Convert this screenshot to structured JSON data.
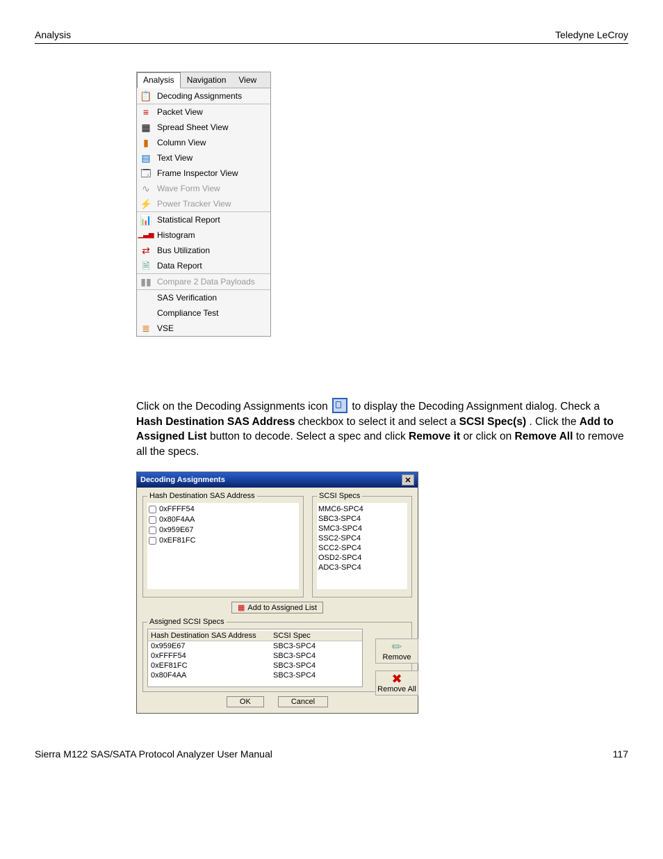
{
  "header": {
    "left": "Analysis",
    "right": "Teledyne LeCroy"
  },
  "menu": {
    "tabs": [
      "Analysis",
      "Navigation",
      "View"
    ],
    "active_tab": 0,
    "sections": [
      [
        {
          "label": "Decoding Assignments",
          "disabled": false
        }
      ],
      [
        {
          "label": "Packet View",
          "disabled": false
        },
        {
          "label": "Spread Sheet View",
          "disabled": false
        },
        {
          "label": "Column View",
          "disabled": false
        },
        {
          "label": "Text View",
          "disabled": false
        },
        {
          "label": "Frame Inspector View",
          "disabled": false
        },
        {
          "label": "Wave Form View",
          "disabled": true
        },
        {
          "label": "Power Tracker View",
          "disabled": true
        }
      ],
      [
        {
          "label": "Statistical Report",
          "disabled": false
        },
        {
          "label": "Histogram",
          "disabled": false
        },
        {
          "label": "Bus Utilization",
          "disabled": false
        },
        {
          "label": "Data Report",
          "disabled": false
        }
      ],
      [
        {
          "label": "Compare 2 Data Payloads",
          "disabled": true
        }
      ],
      [
        {
          "label": "SAS Verification",
          "disabled": false
        },
        {
          "label": "Compliance Test",
          "disabled": false
        },
        {
          "label": "VSE",
          "disabled": false
        }
      ]
    ]
  },
  "paragraph": {
    "p1_a": "Click on the Decoding Assignments icon ",
    "p1_b": " to display the Decoding Assignment dialog. Check a ",
    "p1_bold1": "Hash Destination SAS Address",
    "p1_c": " checkbox to select it and select a ",
    "p1_bold2": "SCSI Spec(s)",
    "p1_d": ". Click the ",
    "p1_bold3": "Add to Assigned List",
    "p1_e": " button to decode. Select a spec and click ",
    "p1_bold4": "Remove it",
    "p1_f": " or click on ",
    "p1_bold5": "Remove All",
    "p1_g": " to remove all the specs."
  },
  "dialog": {
    "title": "Decoding Assignments",
    "hash_legend": "Hash Destination SAS Address",
    "hash_items": [
      "0xFFFF54",
      "0x80F4AA",
      "0x959E67",
      "0xEF81FC"
    ],
    "specs_legend": "SCSI Specs",
    "specs_items": [
      "MMC6-SPC4",
      "SBC3-SPC4",
      "SMC3-SPC4",
      "SSC2-SPC4",
      "SCC2-SPC4",
      "OSD2-SPC4",
      "ADC3-SPC4"
    ],
    "add_btn": "Add  to Assigned List",
    "assigned_legend": "Assigned SCSI Specs",
    "table_head": [
      "Hash Destination SAS Address",
      "SCSI Spec"
    ],
    "table_rows": [
      [
        "0x959E67",
        "SBC3-SPC4"
      ],
      [
        "0xFFFF54",
        "SBC3-SPC4"
      ],
      [
        "0xEF81FC",
        "SBC3-SPC4"
      ],
      [
        "0x80F4AA",
        "SBC3-SPC4"
      ]
    ],
    "remove_btn": "Remove",
    "remove_all_btn": "Remove All",
    "ok": "OK",
    "cancel": "Cancel"
  },
  "footer": {
    "left": "Sierra M122 SAS/SATA Protocol Analyzer User Manual",
    "right": "117"
  },
  "icons": {
    "decoding": "📋",
    "packet": "≡",
    "spread": "▦",
    "column": "▮",
    "text": "▤",
    "frame": "🗔",
    "wave": "∿",
    "power": "⚡",
    "stat": "📊",
    "hist": "▁▃▅",
    "bus": "⇄",
    "data": "🗎",
    "compare": "▮▮",
    "vse": "≣",
    "eraser": "✏",
    "redx": "✖"
  }
}
